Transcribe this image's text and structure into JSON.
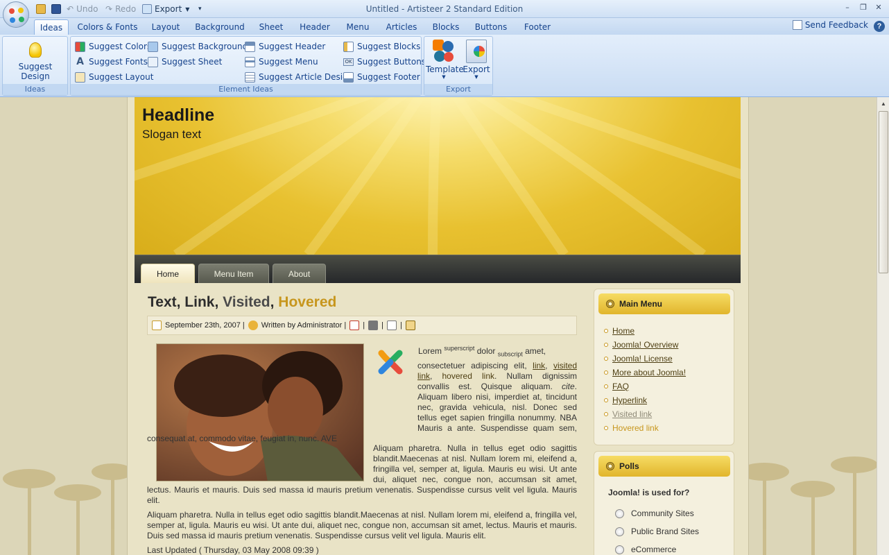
{
  "window": {
    "title": "Untitled - Artisteer 2 Standard Edition",
    "undo_label": "Undo",
    "redo_label": "Redo",
    "export_label": "Export",
    "minimize": "–",
    "maximize": "❐",
    "close": "✕"
  },
  "tabs": [
    "Ideas",
    "Colors & Fonts",
    "Layout",
    "Background",
    "Sheet",
    "Header",
    "Menu",
    "Articles",
    "Blocks",
    "Buttons",
    "Footer"
  ],
  "feedback_label": "Send Feedback",
  "help_label": "?",
  "ribbon": {
    "ideas_group": {
      "label": "Ideas",
      "suggest_design": "Suggest Design"
    },
    "element_group": {
      "label": "Element Ideas",
      "col1": [
        "Suggest Colors",
        "Suggest Fonts",
        "Suggest Layout"
      ],
      "col2": [
        "Suggest Background",
        "Suggest Sheet"
      ],
      "col3": [
        "Suggest Header",
        "Suggest Menu",
        "Suggest Article Design"
      ],
      "col4": [
        "Suggest Blocks",
        "Suggest Buttons",
        "Suggest Footer"
      ]
    },
    "export_group": {
      "label": "Export",
      "template": "Template",
      "export": "Export"
    }
  },
  "site": {
    "headline": "Headline",
    "slogan": "Slogan text",
    "menu": [
      "Home",
      "Menu Item",
      "About"
    ],
    "article": {
      "title_parts": [
        "Text",
        ", ",
        "Link",
        ", ",
        "Visited",
        ", ",
        "Hovered"
      ],
      "date": "September 23th, 2007 |",
      "author": "Written by Administrator |",
      "sep": "|",
      "para1_lead": "Lorem",
      "para1_sup": "superscript",
      "para1_mid": "dolor",
      "para1_sub": "subscript",
      "para1_amet": "amet,",
      "para1_a": "consectetuer adipiscing elit,",
      "para1_link": "link",
      "para1_visited": "visited link",
      "para1_hovered": "hovered link",
      "para1_b": ". Nullam dignissim convallis est. Quisque aliquam.",
      "para1_cite": "cite",
      "para1_c": ". Aliquam libero nisi, imperdiet at, tincidunt nec, gravida vehicula, nisl. Donec sed tellus eget sapien fringilla nonummy. NBA Mauris a ante. Suspendisse quam sem, consequat at, commodo vitae, feugiat in, nunc. AVE",
      "para2": "Aliquam pharetra. Nulla in tellus eget odio sagittis blandit.Maecenas at nisl. Nullam lorem mi, eleifend a, fringilla vel, semper at, ligula. Mauris eu wisi. Ut ante dui, aliquet nec, congue non, accumsan sit amet, lectus. Mauris et mauris. Duis sed massa id mauris pretium venenatis. Suspendisse cursus velit vel ligula. Mauris elit.",
      "para3": "Aliquam pharetra. Nulla in tellus eget odio sagittis blandit.Maecenas at nisl. Nullam lorem mi, eleifend a, fringilla vel, semper at, ligula. Mauris eu wisi. Ut ante dui, aliquet nec, congue non, accumsan sit amet, lectus. Mauris et mauris. Duis sed massa id mauris pretium venenatis. Suspendisse cursus velit vel ligula. Mauris elit.",
      "updated": "Last Updated ( Thursday, 03 May 2008 09:39 )"
    },
    "main_menu": {
      "title": "Main Menu",
      "items": [
        "Home",
        "Joomla! Overview",
        "Joomla! License",
        "More about Joomla!",
        "FAQ",
        "Hyperlink",
        "Visited link",
        "Hovered link"
      ]
    },
    "polls": {
      "title": "Polls",
      "question": "Joomla! is used for?",
      "options": [
        "Community Sites",
        "Public Brand Sites",
        "eCommerce"
      ]
    }
  },
  "colors": {
    "accent": "#c7961d",
    "ribbon": "#15428b",
    "header": "#e8c130"
  }
}
